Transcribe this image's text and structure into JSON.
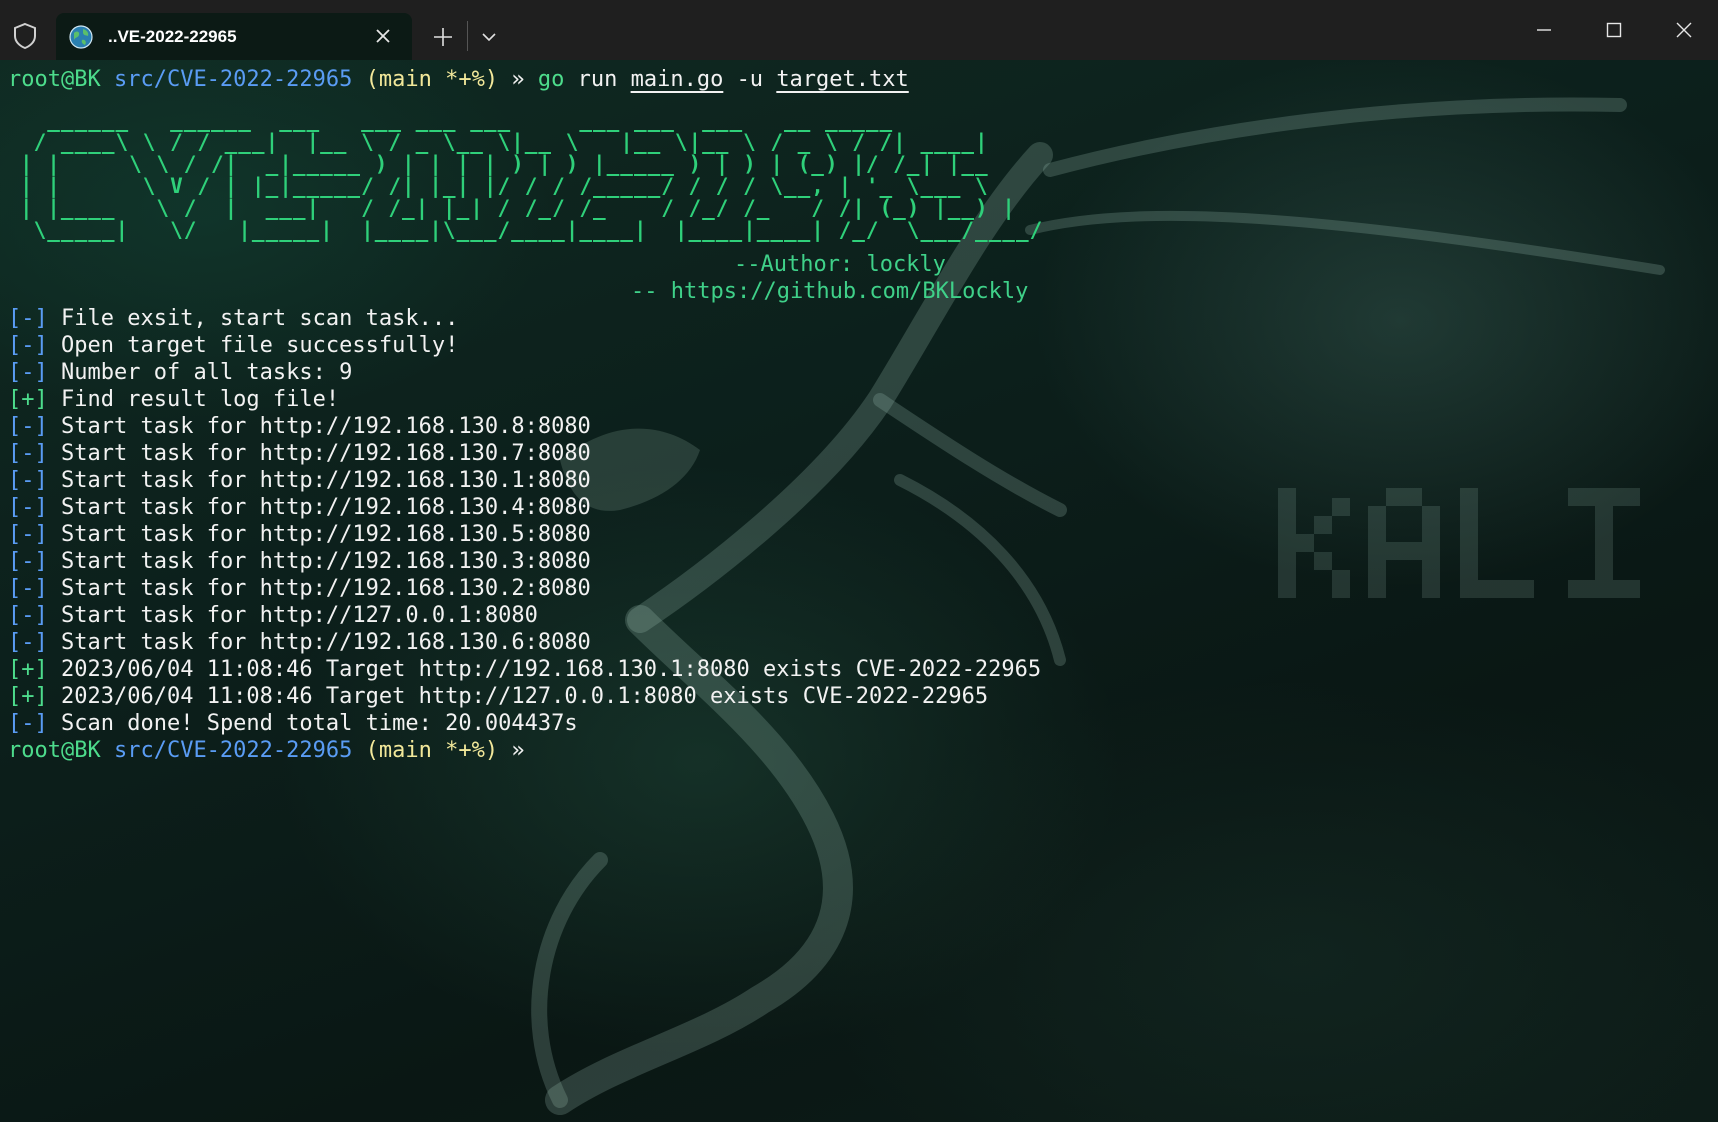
{
  "window": {
    "tab_title": "..VE-2022-22965"
  },
  "prompt": {
    "user": "root@BK",
    "path": "src/CVE-2022-22965",
    "git": "(main *+%)",
    "symbol": "»"
  },
  "command": {
    "bin": "go",
    "sub": "run",
    "file": "main.go",
    "flag": "-u",
    "arg": "target.txt"
  },
  "banner": {
    "ascii": "  ______   ______  ___   ___ ___ ___     ___ ___  ___   __ _____\n / ____\\ \\ / / ___|  |__ \\ / _ \\__ \\|__ \\   |__ \\|__ \\ / _ \\ / /| ____|\n| |     \\ \\ / /|  _|_____ ) | | | | ) | ) |_____ ) | ) | (_) |/ /_| |__\n| |      \\ V / | |_|_____/ /| |_| |/ / / /_____/ / / / \\__, | '_ \\___ \\\n| |____   \\ /  |  ___|   / /_| |_| / /_/ /_    / /_/ /_   / /| (_) |__) |\n \\_____|   \\/   |_____|  |____|\\___/____|____|  |____|____| /_/  \\___/____/",
    "author": "--Author: lockly",
    "link": "-- https://github.com/BKLockly"
  },
  "output": [
    {
      "tag": "[-]",
      "tag_color": "blue",
      "text": "File exsit, start scan task..."
    },
    {
      "tag": "[-]",
      "tag_color": "blue",
      "text": "Open target file successfully!"
    },
    {
      "tag": "[-]",
      "tag_color": "blue",
      "text": "Number of all tasks: 9"
    },
    {
      "tag": "[+]",
      "tag_color": "green",
      "text": "Find result log file!"
    },
    {
      "tag": "[-]",
      "tag_color": "blue",
      "text": "Start task for http://192.168.130.8:8080"
    },
    {
      "tag": "[-]",
      "tag_color": "blue",
      "text": "Start task for http://192.168.130.7:8080"
    },
    {
      "tag": "[-]",
      "tag_color": "blue",
      "text": "Start task for http://192.168.130.1:8080"
    },
    {
      "tag": "[-]",
      "tag_color": "blue",
      "text": "Start task for http://192.168.130.4:8080"
    },
    {
      "tag": "[-]",
      "tag_color": "blue",
      "text": "Start task for http://192.168.130.5:8080"
    },
    {
      "tag": "[-]",
      "tag_color": "blue",
      "text": "Start task for http://192.168.130.3:8080"
    },
    {
      "tag": "[-]",
      "tag_color": "blue",
      "text": "Start task for http://192.168.130.2:8080"
    },
    {
      "tag": "[-]",
      "tag_color": "blue",
      "text": "Start task for http://127.0.0.1:8080"
    },
    {
      "tag": "[-]",
      "tag_color": "blue",
      "text": "Start task for http://192.168.130.6:8080"
    },
    {
      "tag": "[+]",
      "tag_color": "green",
      "text": "2023/06/04 11:08:46 Target http://192.168.130.1:8080 exists CVE-2022-22965"
    },
    {
      "tag": "[+]",
      "tag_color": "green",
      "text": "2023/06/04 11:08:46 Target http://127.0.0.1:8080 exists CVE-2022-22965"
    },
    {
      "tag": "[-]",
      "tag_color": "blue",
      "text": "Scan done! Spend total time: 20.004437s"
    }
  ],
  "wallpaper": {
    "text": "KALI"
  },
  "colors": {
    "prompt_user": "#4ddc8c",
    "prompt_path": "#5a9cf4",
    "prompt_git": "#f2e89a",
    "ascii": "#2fd07a",
    "tag_blue": "#5a9cf4",
    "tag_green": "#4ddc8c"
  }
}
